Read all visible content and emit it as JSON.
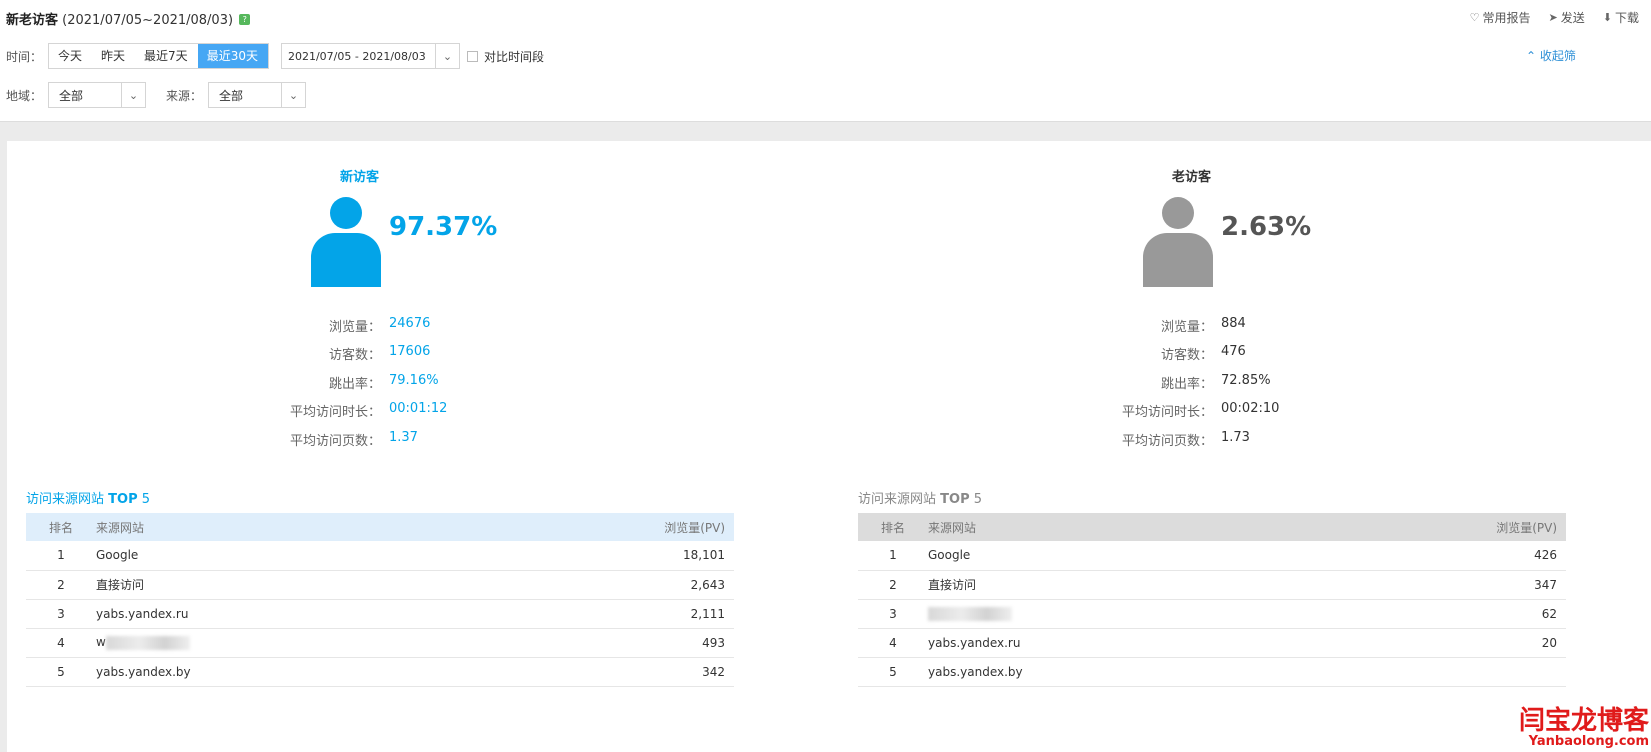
{
  "header": {
    "title": "新老访客",
    "date_range": "(2021/07/05~2021/08/03)",
    "badge": "?",
    "tools": [
      {
        "icon": "heart-icon",
        "glyph": "♡",
        "label": "常用报告"
      },
      {
        "icon": "send-icon",
        "glyph": "➤",
        "label": "发送"
      },
      {
        "icon": "download-icon",
        "glyph": "⬇",
        "label": "下载"
      }
    ],
    "collapse_label": "收起筛"
  },
  "filters": {
    "time_label": "时间：",
    "time_buttons": [
      "今天",
      "昨天",
      "最近7天",
      "最近30天"
    ],
    "active_time": "最近30天",
    "date_value": "2021/07/05 - 2021/08/03",
    "compare_label": "对比时间段",
    "region_label": "地域：",
    "region_value": "全部",
    "source_label": "来源：",
    "source_value": "全部"
  },
  "colors": {
    "new": "#03a4e8",
    "old": "#999999",
    "accent": "#46a7f4"
  },
  "new_visitor": {
    "title": "新访客",
    "percent": "97.37%",
    "stats": [
      {
        "label": "浏览量：",
        "value": "24676"
      },
      {
        "label": "访客数：",
        "value": "17606"
      },
      {
        "label": "跳出率：",
        "value": "79.16%"
      },
      {
        "label": "平均访问时长：",
        "value": "00:01:12"
      },
      {
        "label": "平均访问页数：",
        "value": "1.37"
      }
    ],
    "table_title_prefix": "访问来源网站",
    "table_title_top": "TOP",
    "table_title_num": "5",
    "columns": [
      "排名",
      "来源网站",
      "浏览量(PV)"
    ],
    "rows": [
      {
        "rank": "1",
        "site": "Google",
        "pv": "18,101"
      },
      {
        "rank": "2",
        "site": "直接访问",
        "pv": "2,643"
      },
      {
        "rank": "3",
        "site": "yabs.yandex.ru",
        "pv": "2,111"
      },
      {
        "rank": "4",
        "site": "w",
        "pv": "493"
      },
      {
        "rank": "5",
        "site": "yabs.yandex.by",
        "pv": "342"
      }
    ]
  },
  "old_visitor": {
    "title": "老访客",
    "percent": "2.63%",
    "stats": [
      {
        "label": "浏览量：",
        "value": "884"
      },
      {
        "label": "访客数：",
        "value": "476"
      },
      {
        "label": "跳出率：",
        "value": "72.85%"
      },
      {
        "label": "平均访问时长：",
        "value": "00:02:10"
      },
      {
        "label": "平均访问页数：",
        "value": "1.73"
      }
    ],
    "table_title_prefix": "访问来源网站",
    "table_title_top": "TOP",
    "table_title_num": "5",
    "columns": [
      "排名",
      "来源网站",
      "浏览量(PV)"
    ],
    "rows": [
      {
        "rank": "1",
        "site": "Google",
        "pv": "426"
      },
      {
        "rank": "2",
        "site": "直接访问",
        "pv": "347"
      },
      {
        "rank": "3",
        "site": "",
        "pv": "62"
      },
      {
        "rank": "4",
        "site": "yabs.yandex.ru",
        "pv": "20"
      },
      {
        "rank": "5",
        "site": "yabs.yandex.by",
        "pv": ""
      }
    ]
  },
  "watermark": {
    "cn": "闫宝龙博客",
    "en": "Yanbaolong.com"
  }
}
